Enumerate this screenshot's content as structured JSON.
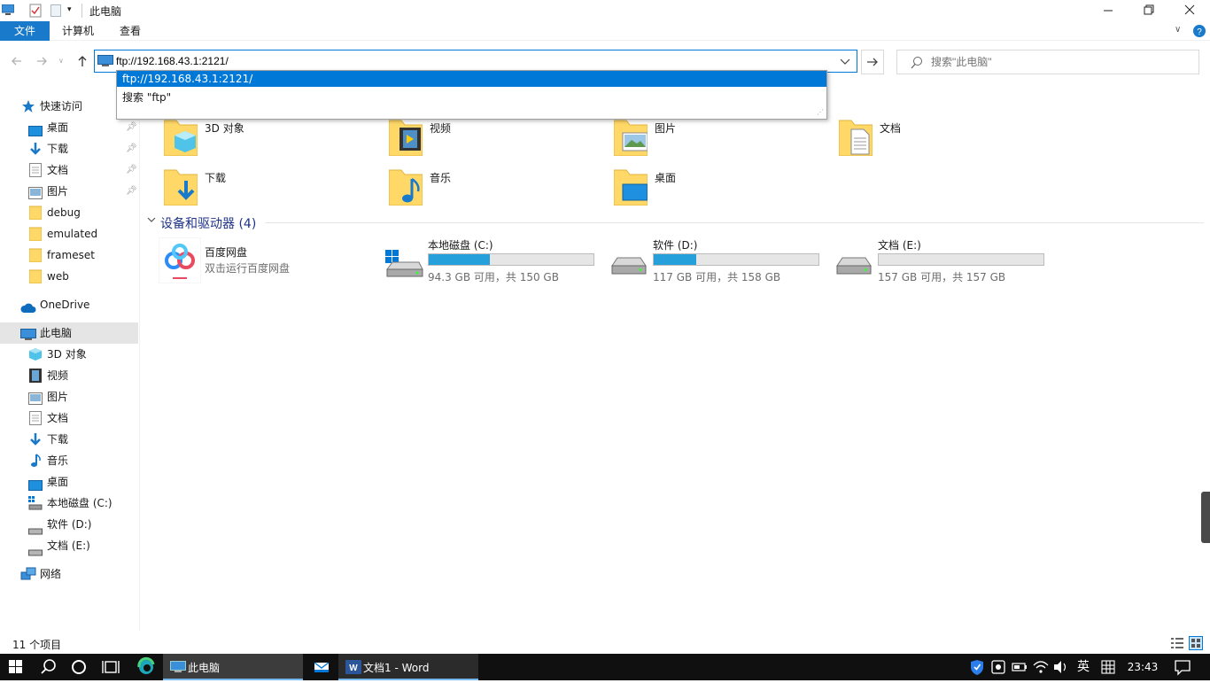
{
  "window": {
    "title": "此电脑"
  },
  "ribbon": {
    "file_tab": "文件",
    "computer_tab": "计算机",
    "view_tab": "查看"
  },
  "address": {
    "value": "ftp://192.168.43.1:2121/",
    "suggestions": [
      "ftp://192.168.43.1:2121/",
      "搜索 \"ftp\""
    ]
  },
  "search": {
    "placeholder": "搜索\"此电脑\""
  },
  "sidebar": {
    "quick_access": "快速访问",
    "quick_items": [
      "桌面",
      "下载",
      "文档",
      "图片",
      "debug",
      "emulated",
      "frameset",
      "web"
    ],
    "onedrive": "OneDrive",
    "this_pc": "此电脑",
    "pc_items": [
      "3D 对象",
      "视频",
      "图片",
      "文档",
      "下载",
      "音乐",
      "桌面",
      "本地磁盘 (C:)",
      "软件 (D:)",
      "文档 (E:)"
    ],
    "network": "网络"
  },
  "folders": [
    "3D 对象",
    "视频",
    "图片",
    "文档",
    "下载",
    "音乐",
    "桌面"
  ],
  "devices": {
    "header": "设备和驱动器 (4)",
    "baidu": {
      "name": "百度网盘",
      "desc": "双击运行百度网盘"
    },
    "drives": [
      {
        "name": "本地磁盘 (C:)",
        "info": "94.3 GB 可用，共 150 GB",
        "used_fraction": 0.371
      },
      {
        "name": "软件 (D:)",
        "info": "117 GB 可用，共 158 GB",
        "used_fraction": 0.259
      },
      {
        "name": "文档 (E:)",
        "info": "157 GB 可用，共 157 GB",
        "used_fraction": 0.0
      }
    ]
  },
  "status": {
    "count": "11 个项目"
  },
  "taskbar": {
    "explorer_label": "此电脑",
    "word_label": "文档1 - Word",
    "ime": "英",
    "time": "23:43"
  },
  "colors": {
    "accent": "#0078d7",
    "drive_fill": "#26a0da",
    "selected_row": "#e5e5e5",
    "taskbar": "#101010"
  }
}
